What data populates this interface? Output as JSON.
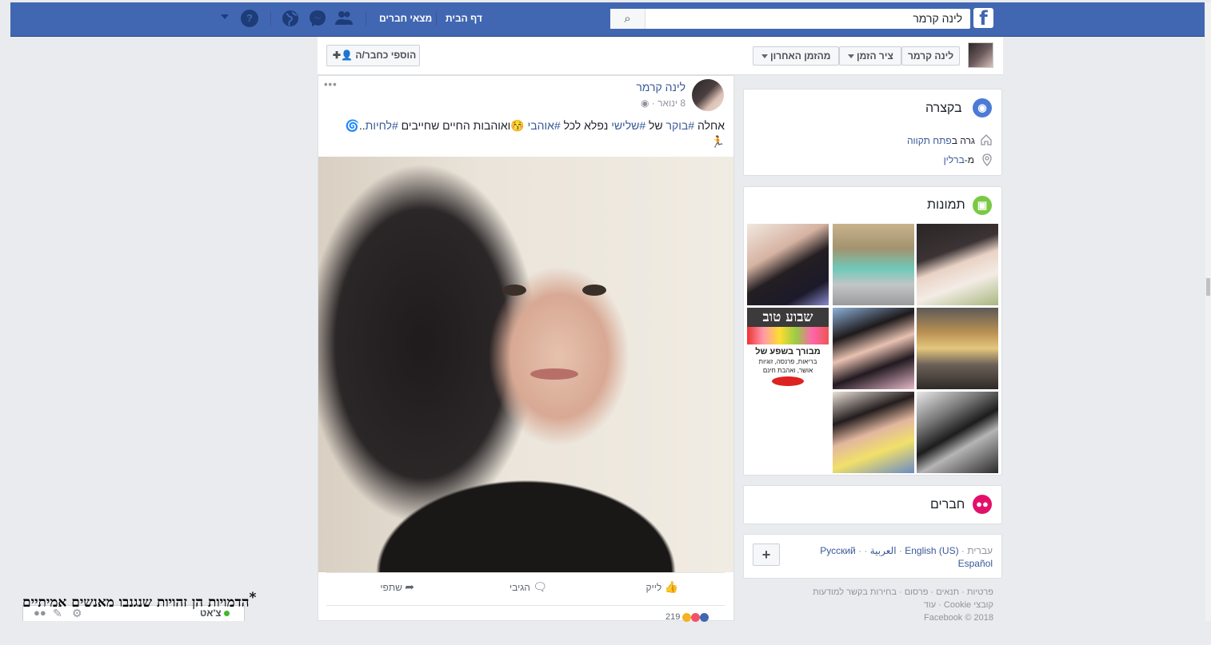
{
  "topbar": {
    "search_value": "לינה קרמר",
    "nav_home": "דף הבית",
    "nav_find_friends": "מצאי חברים",
    "help_icon": "?"
  },
  "timeline_nav": {
    "profile_name": "לינה קרמר",
    "timeline_label": "ציר הזמן",
    "recent_label": "מהזמן האחרון",
    "add_friend": "הוספי כחבר/ה"
  },
  "intro": {
    "title": "בקצרה",
    "lives_prefix": "גרה ב",
    "lives_city": "פתח תקווה",
    "from_prefix": "מ-",
    "from_city": "ברלין"
  },
  "photos": {
    "title": "תמונות",
    "sign_title": "שבוע טוב",
    "sign_line1": "מבורך בשפע של",
    "sign_line2": "בריאות, פרנסה, זוגיות",
    "sign_line3": "אושר, ואהבת חינם"
  },
  "friends": {
    "title": "חברים"
  },
  "languages": {
    "current": "עברית",
    "options": [
      "English (US)",
      "العربية",
      "Русский",
      "Español"
    ],
    "add": "+"
  },
  "footer": {
    "line1": "פרטיות · תנאים · פרסום · בחירות בקשר למודעות",
    "line2": "קובצי Cookie · עוד",
    "copyright": "Facebook © 2018"
  },
  "post": {
    "author": "לינה קרמר",
    "date": "8 ינואר",
    "menu": "•••",
    "text_line1_prefix": "אחלה ",
    "tag1": "#בוקר",
    "w1": " של ",
    "tag2": "#שלישי",
    "w2": " נפלא לכל ",
    "tag3": "#אוהבי",
    "w3": " 😚ואוהבות החיים שחייבים ",
    "tag4": "#לחיות",
    "w4": "..🌀",
    "text_line2": "🏃",
    "like": "לייק",
    "comment": "הגיבי",
    "share": "שתפי",
    "reactions_count": "219"
  },
  "chat": {
    "label": "צ'אט"
  },
  "overlay": {
    "note": "הדמויות הן זהויות שנגנבו מאנשים אמיתיים",
    "star": "*"
  }
}
